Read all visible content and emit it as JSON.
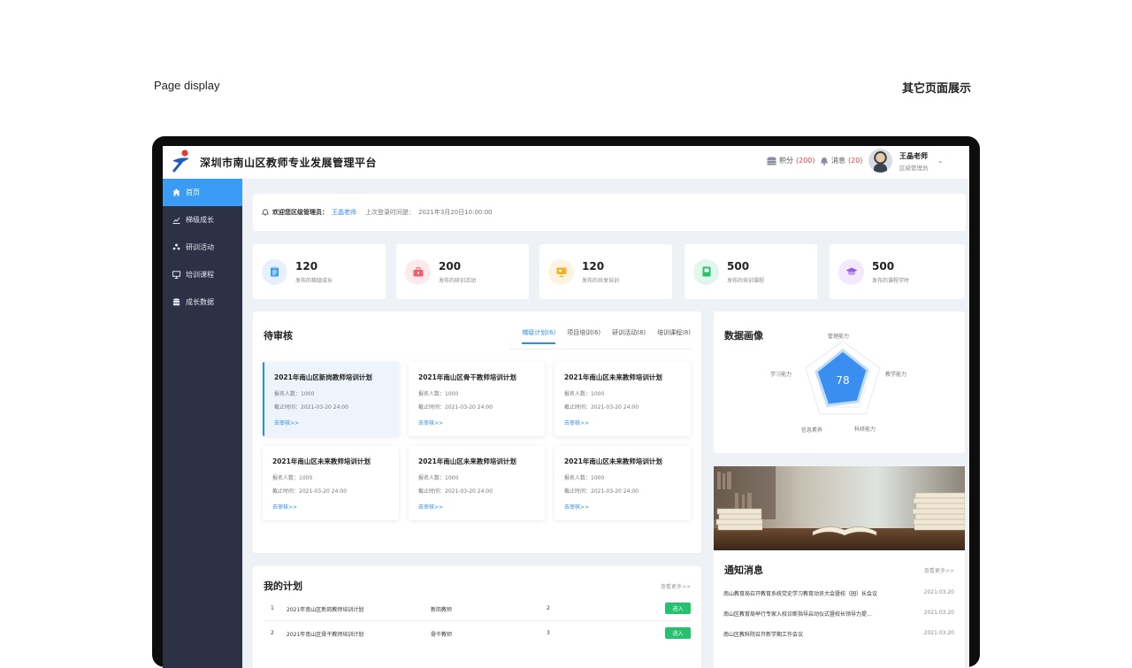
{
  "captions": {
    "left": "Page display",
    "right": "其它页面展示"
  },
  "header": {
    "brand": "深圳市南山区教师专业发展管理平台",
    "points_label": "积分",
    "points_value": "(200)",
    "messages_label": "消息",
    "messages_value": "(20)",
    "user_name": "王晶老师",
    "user_role": "区级管理员"
  },
  "sidebar": {
    "items": [
      {
        "label": "首页",
        "icon": "home-icon",
        "active": true
      },
      {
        "label": "梯级成长",
        "icon": "chart-icon"
      },
      {
        "label": "研训活动",
        "icon": "people-icon"
      },
      {
        "label": "培训课程",
        "icon": "screen-icon"
      },
      {
        "label": "成长数据",
        "icon": "database-icon"
      }
    ]
  },
  "welcome": {
    "prefix": "欢迎您区级管理员：",
    "name": "王晶老师",
    "last_login_label": "上次登录时间是：",
    "last_login_time": "2021年3月20日10:00:00"
  },
  "stats": [
    {
      "value": "120",
      "label": "发布的梯级成长",
      "icon": "clipboard-icon",
      "color": "#3a9cf4"
    },
    {
      "value": "200",
      "label": "发布的研训活动",
      "icon": "briefcase-icon",
      "color": "#f0606a"
    },
    {
      "value": "120",
      "label": "发布的共享培训",
      "icon": "presentation-icon",
      "color": "#f3b12e"
    },
    {
      "value": "500",
      "label": "发布的培训课程",
      "icon": "book-icon",
      "color": "#25c16f"
    },
    {
      "value": "500",
      "label": "发布的课程学时",
      "icon": "graduation-cap-icon",
      "color": "#9b59e6"
    }
  ],
  "pending": {
    "title": "待审核",
    "tabs": [
      "梯级计划(6)",
      "项目培训(6)",
      "研训活动(8)",
      "培训课程(8)"
    ],
    "cards": [
      {
        "title": "2021年南山区新岗教师培训计划",
        "enroll": "报名人数：1000",
        "deadline": "截止时间：2021-03-20 24:00",
        "link": "去审核>>"
      },
      {
        "title": "2021年南山区骨干教师培训计划",
        "enroll": "报名人数：1000",
        "deadline": "截止时间：2021-03-20 24:00",
        "link": "去审核>>"
      },
      {
        "title": "2021年南山区未来教师培训计划",
        "enroll": "报名人数：1000",
        "deadline": "截止时间：2021-03-20 24:00",
        "link": "去审核>>"
      },
      {
        "title": "2021年南山区未来教师培训计划",
        "enroll": "报名人数：1000",
        "deadline": "截止时间：2021-03-20 24:00",
        "link": "去审核>>"
      },
      {
        "title": "2021年南山区未来教师培训计划",
        "enroll": "报名人数：1000",
        "deadline": "截止时间：2021-03-20 24:00",
        "link": "去审核>>"
      },
      {
        "title": "2021年南山区未来教师培训计划",
        "enroll": "报名人数：1000",
        "deadline": "截止时间：2021-03-20 24:00",
        "link": "去审核>>"
      }
    ]
  },
  "portrait": {
    "title": "数据画像",
    "score": "78",
    "axes": [
      "管理能力",
      "教学能力",
      "科研能力",
      "信息素养",
      "学习能力"
    ]
  },
  "notice": {
    "title": "通知消息",
    "more": "查看更多>>",
    "items": [
      {
        "text": "南山教育局召开教育系统党史学习教育动员大会暨校（园）长会议",
        "date": "2021.03.20"
      },
      {
        "text": "南山区教育局举行专家入校诊断指导启动仪式暨校长领导力提...",
        "date": "2021.03.20"
      },
      {
        "text": "南山区教科院召开新学期工作会议",
        "date": "2021.03.20"
      }
    ]
  },
  "plan": {
    "title": "我的计划",
    "more": "查看更多>>",
    "rows": [
      {
        "no": "1",
        "name": "2021年南山区新岗教师培训计划",
        "type": "新岗教师",
        "count": "2",
        "action": "进入"
      },
      {
        "no": "2",
        "name": "2021年南山区骨干教师培训计划",
        "type": "骨干教师",
        "count": "3",
        "action": "进入"
      }
    ]
  }
}
